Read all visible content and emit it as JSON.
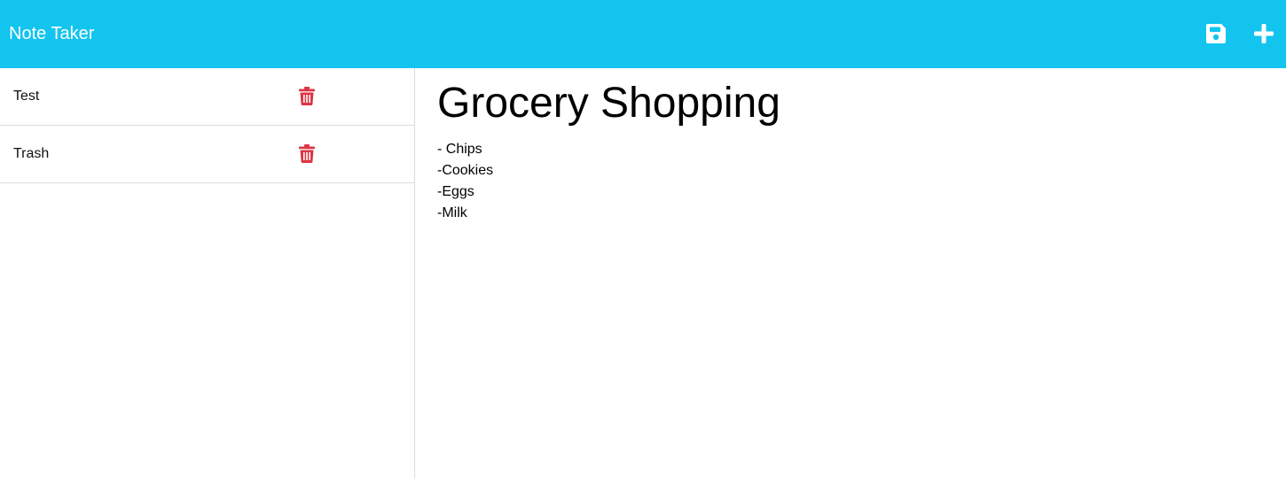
{
  "app": {
    "title": "Note Taker"
  },
  "toolbar": {
    "save_icon": "floppy-disk-icon",
    "new_note_icon": "plus-icon"
  },
  "colors": {
    "navbar_background": "#13c4ef",
    "navbar_text": "#ffffff",
    "delete_icon": "#dc3545",
    "divider": "#dcdcdc"
  },
  "sidebar": {
    "notes": [
      {
        "title": "Test",
        "delete_icon": "trash-icon"
      },
      {
        "title": "Trash",
        "delete_icon": "trash-icon"
      }
    ]
  },
  "editor": {
    "title": "Grocery Shopping",
    "body": "- Chips\n-Cookies\n-Eggs\n-Milk"
  }
}
